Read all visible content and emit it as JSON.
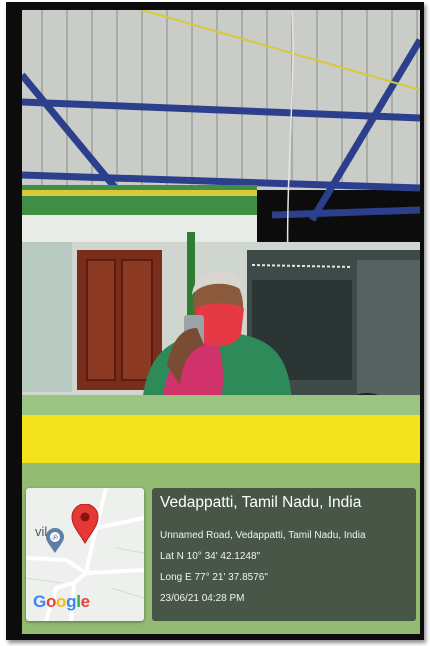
{
  "geo_tag": {
    "title": "Vedappatti, Tamil Nadu, India",
    "address": "Unnamed Road, Vedappatti, Tamil Nadu, India",
    "latitude": "Lat N 10° 34' 42.1248\"",
    "longitude": "Long E 77° 21' 37.8576\"",
    "timestamp": "23/06/21 04:28 PM"
  },
  "map": {
    "place_fragment": "vil",
    "brand_letters": [
      "G",
      "o",
      "o",
      "g",
      "l",
      "e"
    ],
    "brand_colors": [
      "#4285F4",
      "#EA4335",
      "#FBBC05",
      "#4285F4",
      "#34A853",
      "#EA4335"
    ],
    "marker_icon": "location-pin-icon",
    "poi_icon": "temple-om-icon"
  }
}
